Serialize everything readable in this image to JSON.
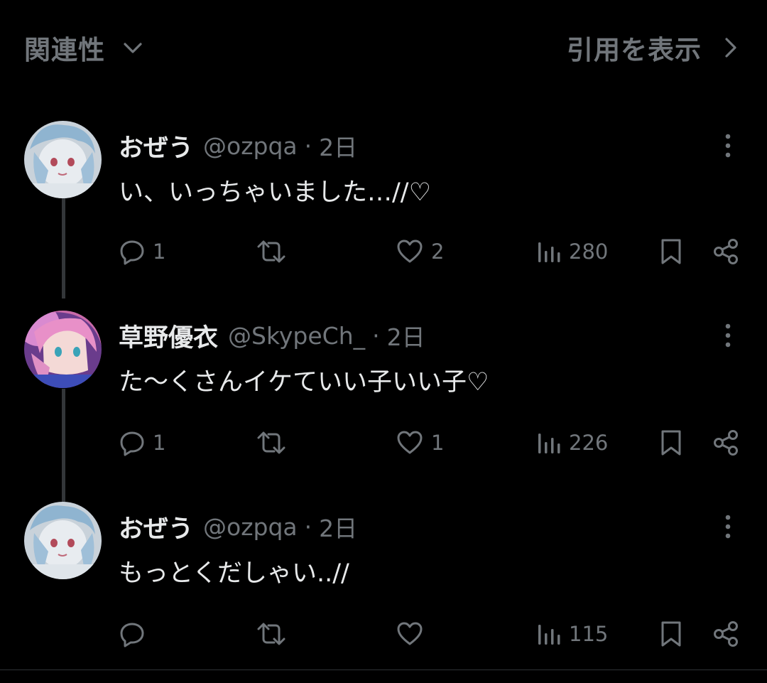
{
  "topbar": {
    "sort_label": "関連性",
    "quotes_label": "引用を表示"
  },
  "replies": [
    {
      "name": "おぜう",
      "handle": "@ozpqa",
      "separator": "·",
      "time": "2日",
      "text": "い、いっちゃいました…//♡",
      "counts": {
        "reply": "1",
        "retweet": "",
        "like": "2",
        "views": "280"
      },
      "avatar": "anime-girl-light-blue-hair"
    },
    {
      "name": "草野優衣",
      "handle": "@SkypeCh_",
      "separator": "·",
      "time": "2日",
      "text": "た〜くさんイケていい子いい子♡",
      "counts": {
        "reply": "1",
        "retweet": "",
        "like": "1",
        "views": "226"
      },
      "avatar": "anime-girl-pink-hair"
    },
    {
      "name": "おぜう",
      "handle": "@ozpqa",
      "separator": "·",
      "time": "2日",
      "text": "もっとくだしゃい..//",
      "counts": {
        "reply": "",
        "retweet": "",
        "like": "",
        "views": "115"
      },
      "avatar": "anime-girl-light-blue-hair"
    }
  ],
  "icons": {
    "sort": "chevron-down-icon",
    "quotes": "chevron-right-icon",
    "more": "more-vertical-icon",
    "reply": "reply-bubble-icon",
    "retweet": "retweet-icon",
    "like": "heart-icon",
    "views": "views-bar-icon",
    "bookmark": "bookmark-icon",
    "share": "share-icon"
  },
  "colors": {
    "background": "#000000",
    "primary_text": "#e7e9ea",
    "secondary_text": "#71767b",
    "thread_line": "#333639"
  }
}
